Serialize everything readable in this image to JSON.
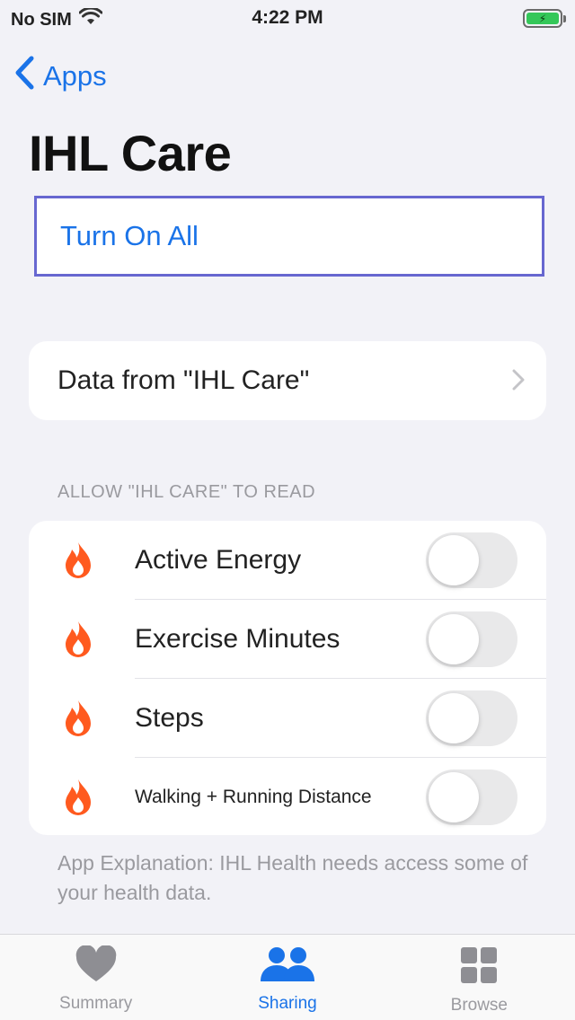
{
  "status_bar": {
    "carrier": "No SIM",
    "time": "4:22 PM"
  },
  "nav": {
    "back_label": "Apps"
  },
  "page": {
    "title": "IHL Care"
  },
  "turn_on_all": {
    "label": "Turn On All"
  },
  "data_from": {
    "label": "Data from \"IHL Care\""
  },
  "read_section": {
    "header": "ALLOW \"IHL CARE\" TO READ",
    "items": [
      {
        "label": "Active Energy",
        "enabled": false,
        "icon": "flame-icon"
      },
      {
        "label": "Exercise Minutes",
        "enabled": false,
        "icon": "flame-icon"
      },
      {
        "label": "Steps",
        "enabled": false,
        "icon": "flame-icon"
      },
      {
        "label": "Walking + Running Distance",
        "enabled": false,
        "icon": "flame-icon"
      }
    ]
  },
  "footnote": "App Explanation: IHL Health needs access some of your health data.",
  "tab_bar": {
    "tabs": [
      {
        "label": "Summary",
        "icon": "heart-icon",
        "active": false
      },
      {
        "label": "Sharing",
        "icon": "people-icon",
        "active": true
      },
      {
        "label": "Browse",
        "icon": "grid-icon",
        "active": false
      }
    ]
  },
  "colors": {
    "accent": "#1a73e8",
    "flame": "#ff5a1f",
    "background": "#f2f2f7"
  }
}
